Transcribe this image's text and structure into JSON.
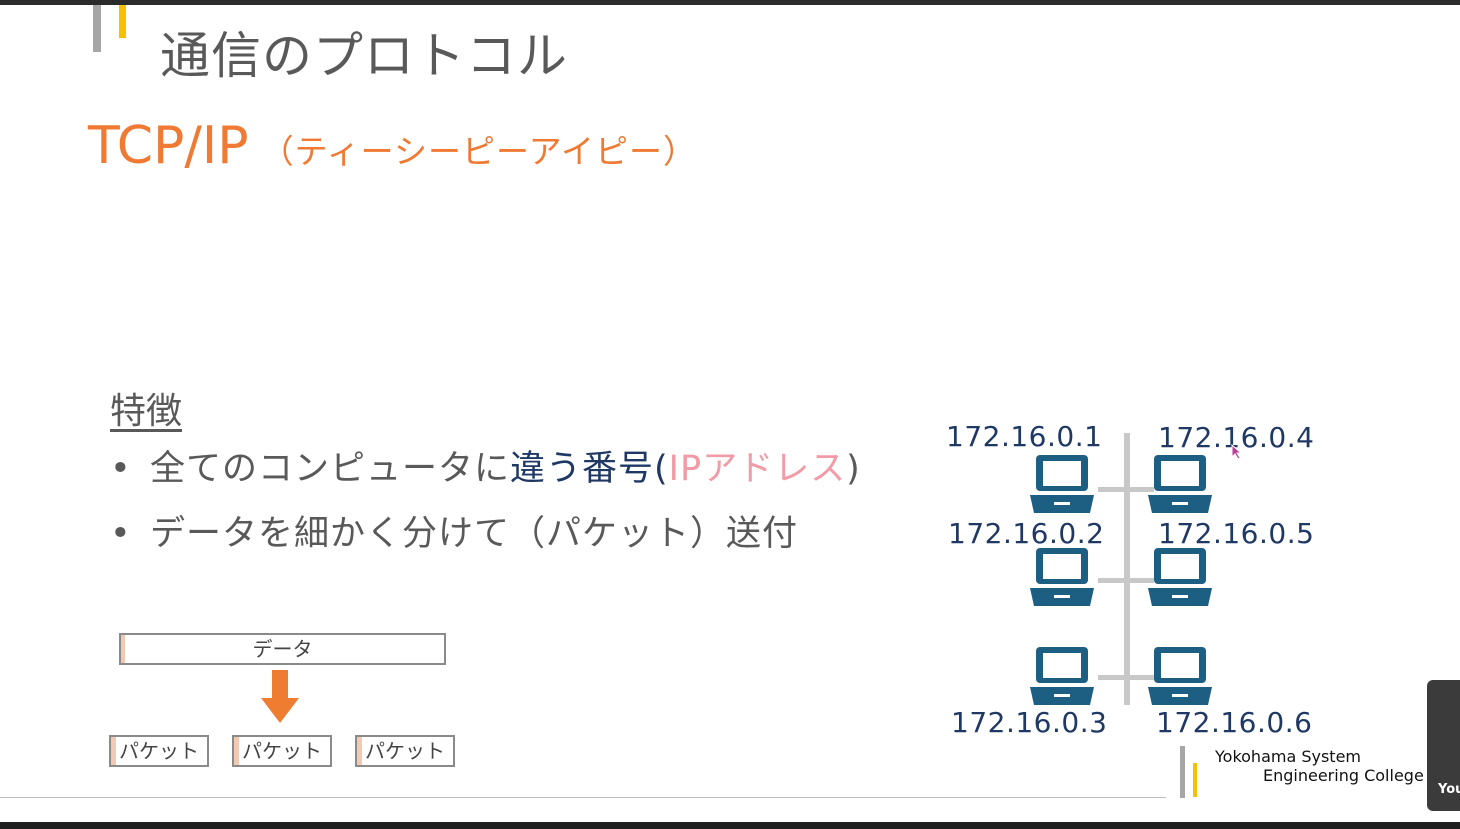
{
  "slide": {
    "title": "通信のプロトコル",
    "subtitle_main": "TCP/IP",
    "subtitle_reading": "（ティーシーピーアイピー）",
    "features_heading": "特徴",
    "bullet_marker": "•",
    "bullets": [
      {
        "pre": "全てのコンピュータに",
        "highlight_blue": "違う番号(",
        "highlight_pink": "IPアドレス",
        "post": ")"
      },
      {
        "text": "データを細かく分けて（パケット）送付"
      }
    ],
    "packet_diagram": {
      "data_label": "データ",
      "packets": [
        "パケット",
        "パケット",
        "パケット"
      ]
    },
    "network": {
      "ips_left": [
        "172.16.0.1",
        "172.16.0.2",
        "172.16.0.3"
      ],
      "ips_right": [
        "172.16.0.4",
        "172.16.0.5",
        "172.16.0.6"
      ]
    }
  },
  "logo": {
    "line1": "Yokohama System",
    "line2": "Engineering College"
  },
  "side_panel": {
    "label": "You"
  },
  "colors": {
    "title_grey": "#595959",
    "accent_orange": "#f07a33",
    "ip_navy": "#1f3864",
    "laptop_blue": "#1c5f82",
    "pink": "#f29aa5",
    "logo_yellow": "#f5c000"
  },
  "icons": [
    "laptop-icon",
    "down-arrow-icon",
    "mouse-cursor-icon"
  ]
}
